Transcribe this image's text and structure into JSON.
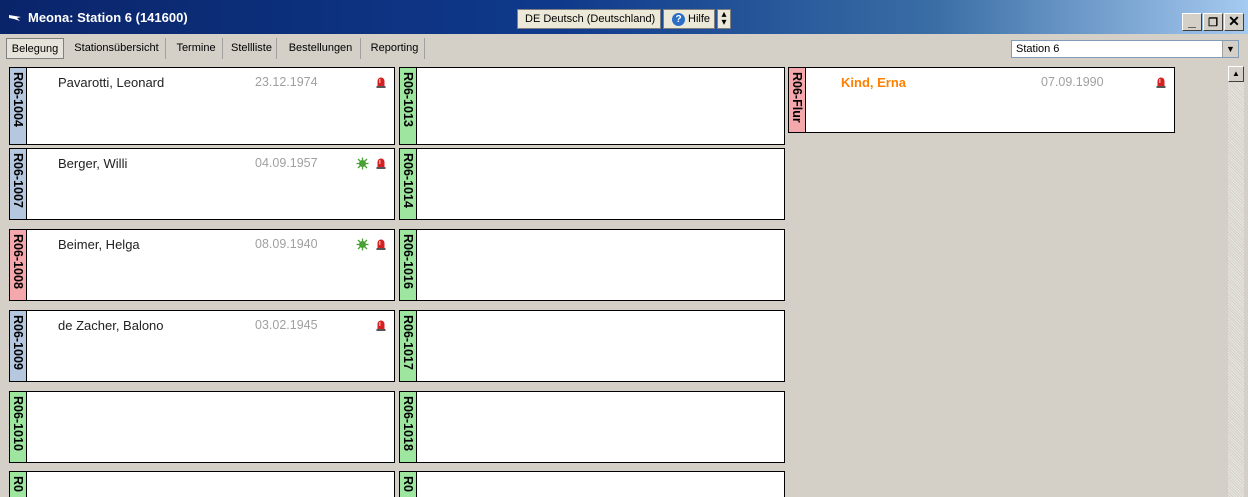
{
  "title": "Meona: Station 6 (141600)",
  "language_label": "DE Deutsch (Deutschland)",
  "help_label": "Hilfe",
  "tabs": [
    "Belegung",
    "Stationsübersicht",
    "Termine",
    "Stellliste",
    "Bestellungen",
    "Reporting"
  ],
  "station_select": "Station 6",
  "colors": {
    "green": "#9ee6a0",
    "blue": "#b6c8e0",
    "pink": "#f4a8ac",
    "orange": "#ff8000"
  },
  "rooms": [
    {
      "id": "R06-1004",
      "patient": "Pavarotti, Leonard",
      "dob": "23.12.1974",
      "alarm": true,
      "germ": false,
      "color": "blue"
    },
    {
      "id": "R06-1007",
      "patient": "Berger, Willi",
      "dob": "04.09.1957",
      "alarm": true,
      "germ": true,
      "color": "blue"
    },
    {
      "id": "R06-1008",
      "patient": "Beimer, Helga",
      "dob": "08.09.1940",
      "alarm": true,
      "germ": true,
      "color": "pink"
    },
    {
      "id": "R06-1009",
      "patient": "de Zacher, Balono",
      "dob": "03.02.1945",
      "alarm": true,
      "germ": false,
      "color": "blue"
    },
    {
      "id": "R06-1010",
      "patient": "",
      "dob": "",
      "alarm": false,
      "germ": false,
      "color": "green"
    },
    {
      "id": "R0",
      "patient": "",
      "dob": "",
      "alarm": false,
      "germ": false,
      "color": "green"
    },
    {
      "id": "R06-1013",
      "patient": "",
      "dob": "",
      "alarm": false,
      "germ": false,
      "color": "green"
    },
    {
      "id": "R06-1014",
      "patient": "",
      "dob": "",
      "alarm": false,
      "germ": false,
      "color": "green"
    },
    {
      "id": "R06-1016",
      "patient": "",
      "dob": "",
      "alarm": false,
      "germ": false,
      "color": "green"
    },
    {
      "id": "R06-1017",
      "patient": "",
      "dob": "",
      "alarm": false,
      "germ": false,
      "color": "green"
    },
    {
      "id": "R06-1018",
      "patient": "",
      "dob": "",
      "alarm": false,
      "germ": false,
      "color": "green"
    },
    {
      "id": "R0",
      "patient": "",
      "dob": "",
      "alarm": false,
      "germ": false,
      "color": "green"
    },
    {
      "id": "R06-Flur",
      "patient": "Kind, Erna",
      "dob": "07.09.1990",
      "alarm": true,
      "germ": false,
      "color": "pink",
      "highlight": true
    }
  ]
}
